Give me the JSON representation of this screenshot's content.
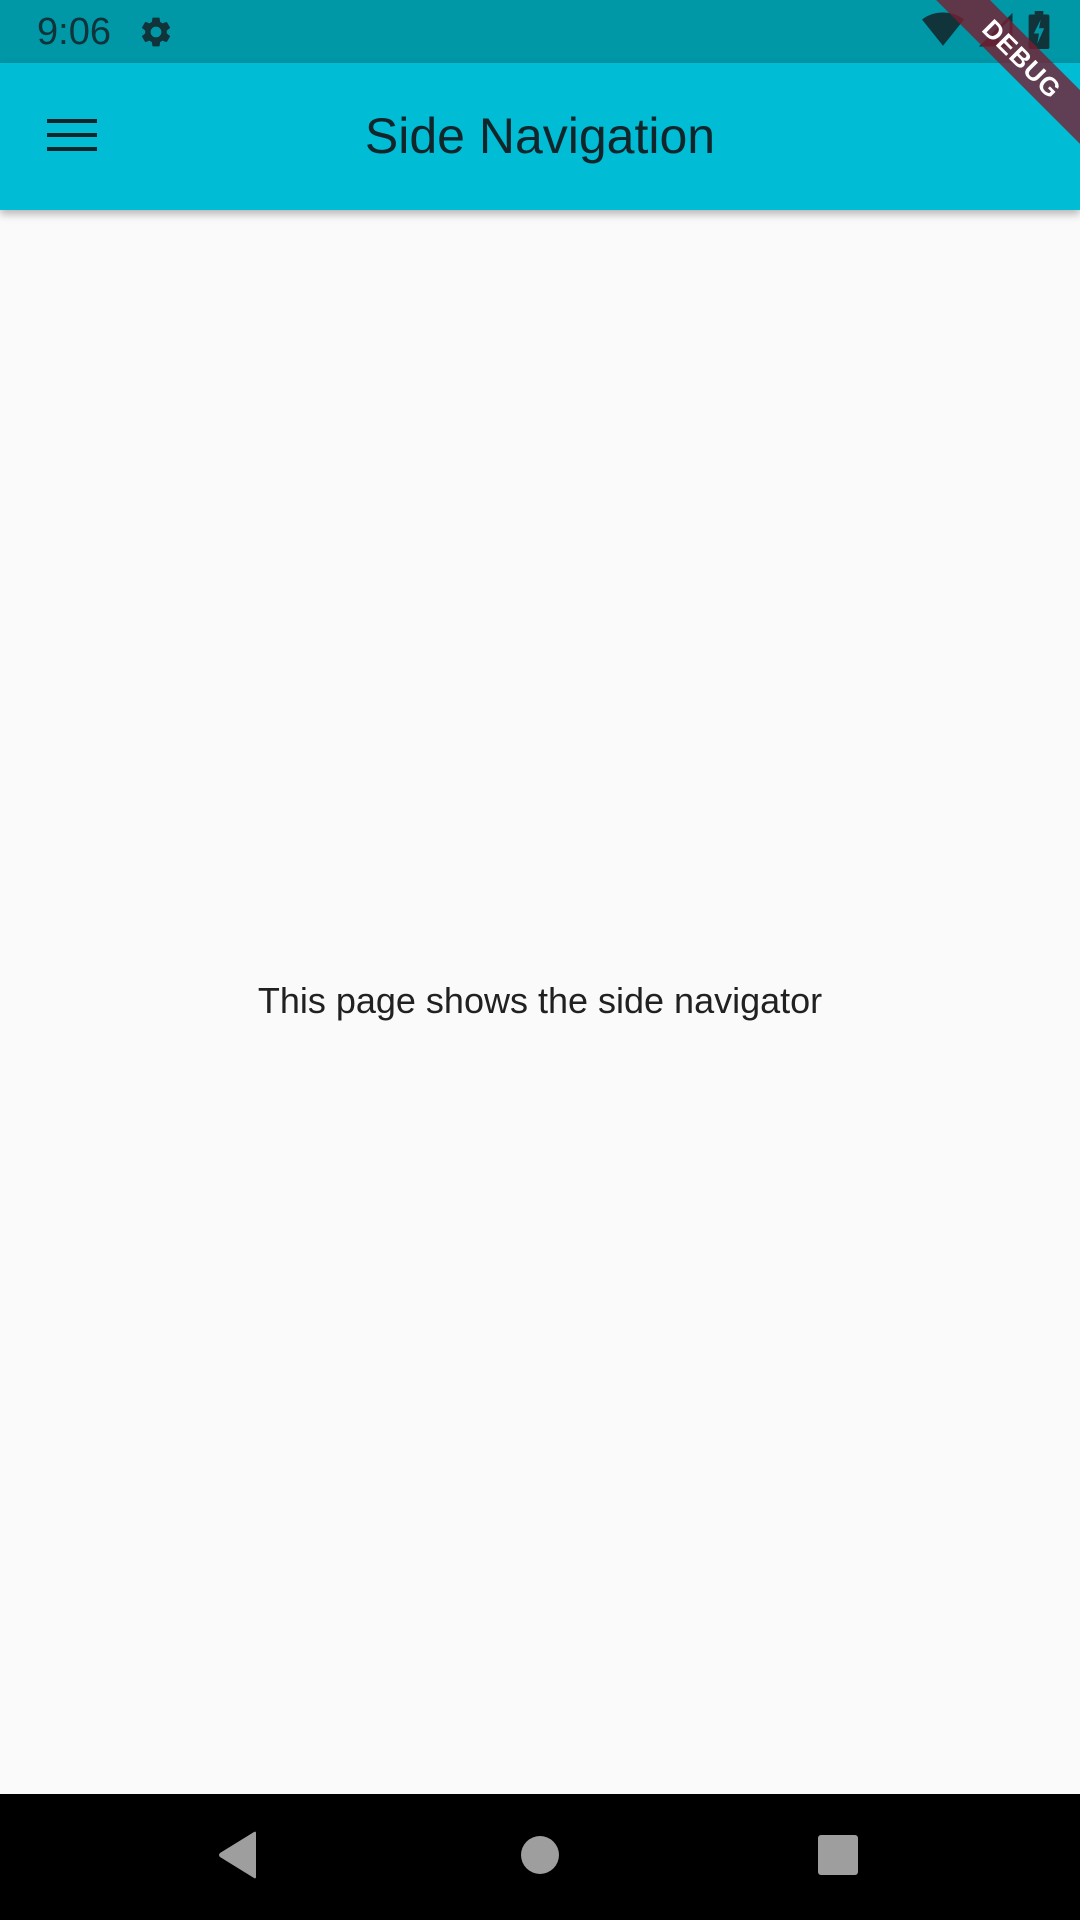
{
  "status_bar": {
    "time": "9:06",
    "icons": [
      "gear-icon",
      "wifi-icon",
      "cell-signal-icon",
      "battery-charging-icon"
    ]
  },
  "app_bar": {
    "title": "Side Navigation",
    "menu_icon": "hamburger-menu-icon"
  },
  "body": {
    "message": "This page shows the side navigator"
  },
  "debug_banner": {
    "label": "DEBUG"
  },
  "nav_bar": {
    "buttons": [
      "back-icon",
      "home-icon",
      "recents-icon"
    ]
  },
  "colors": {
    "status_bar": "#0097a7",
    "app_bar": "#00bcd4",
    "background": "#fafafa",
    "nav_bar": "#000000"
  }
}
